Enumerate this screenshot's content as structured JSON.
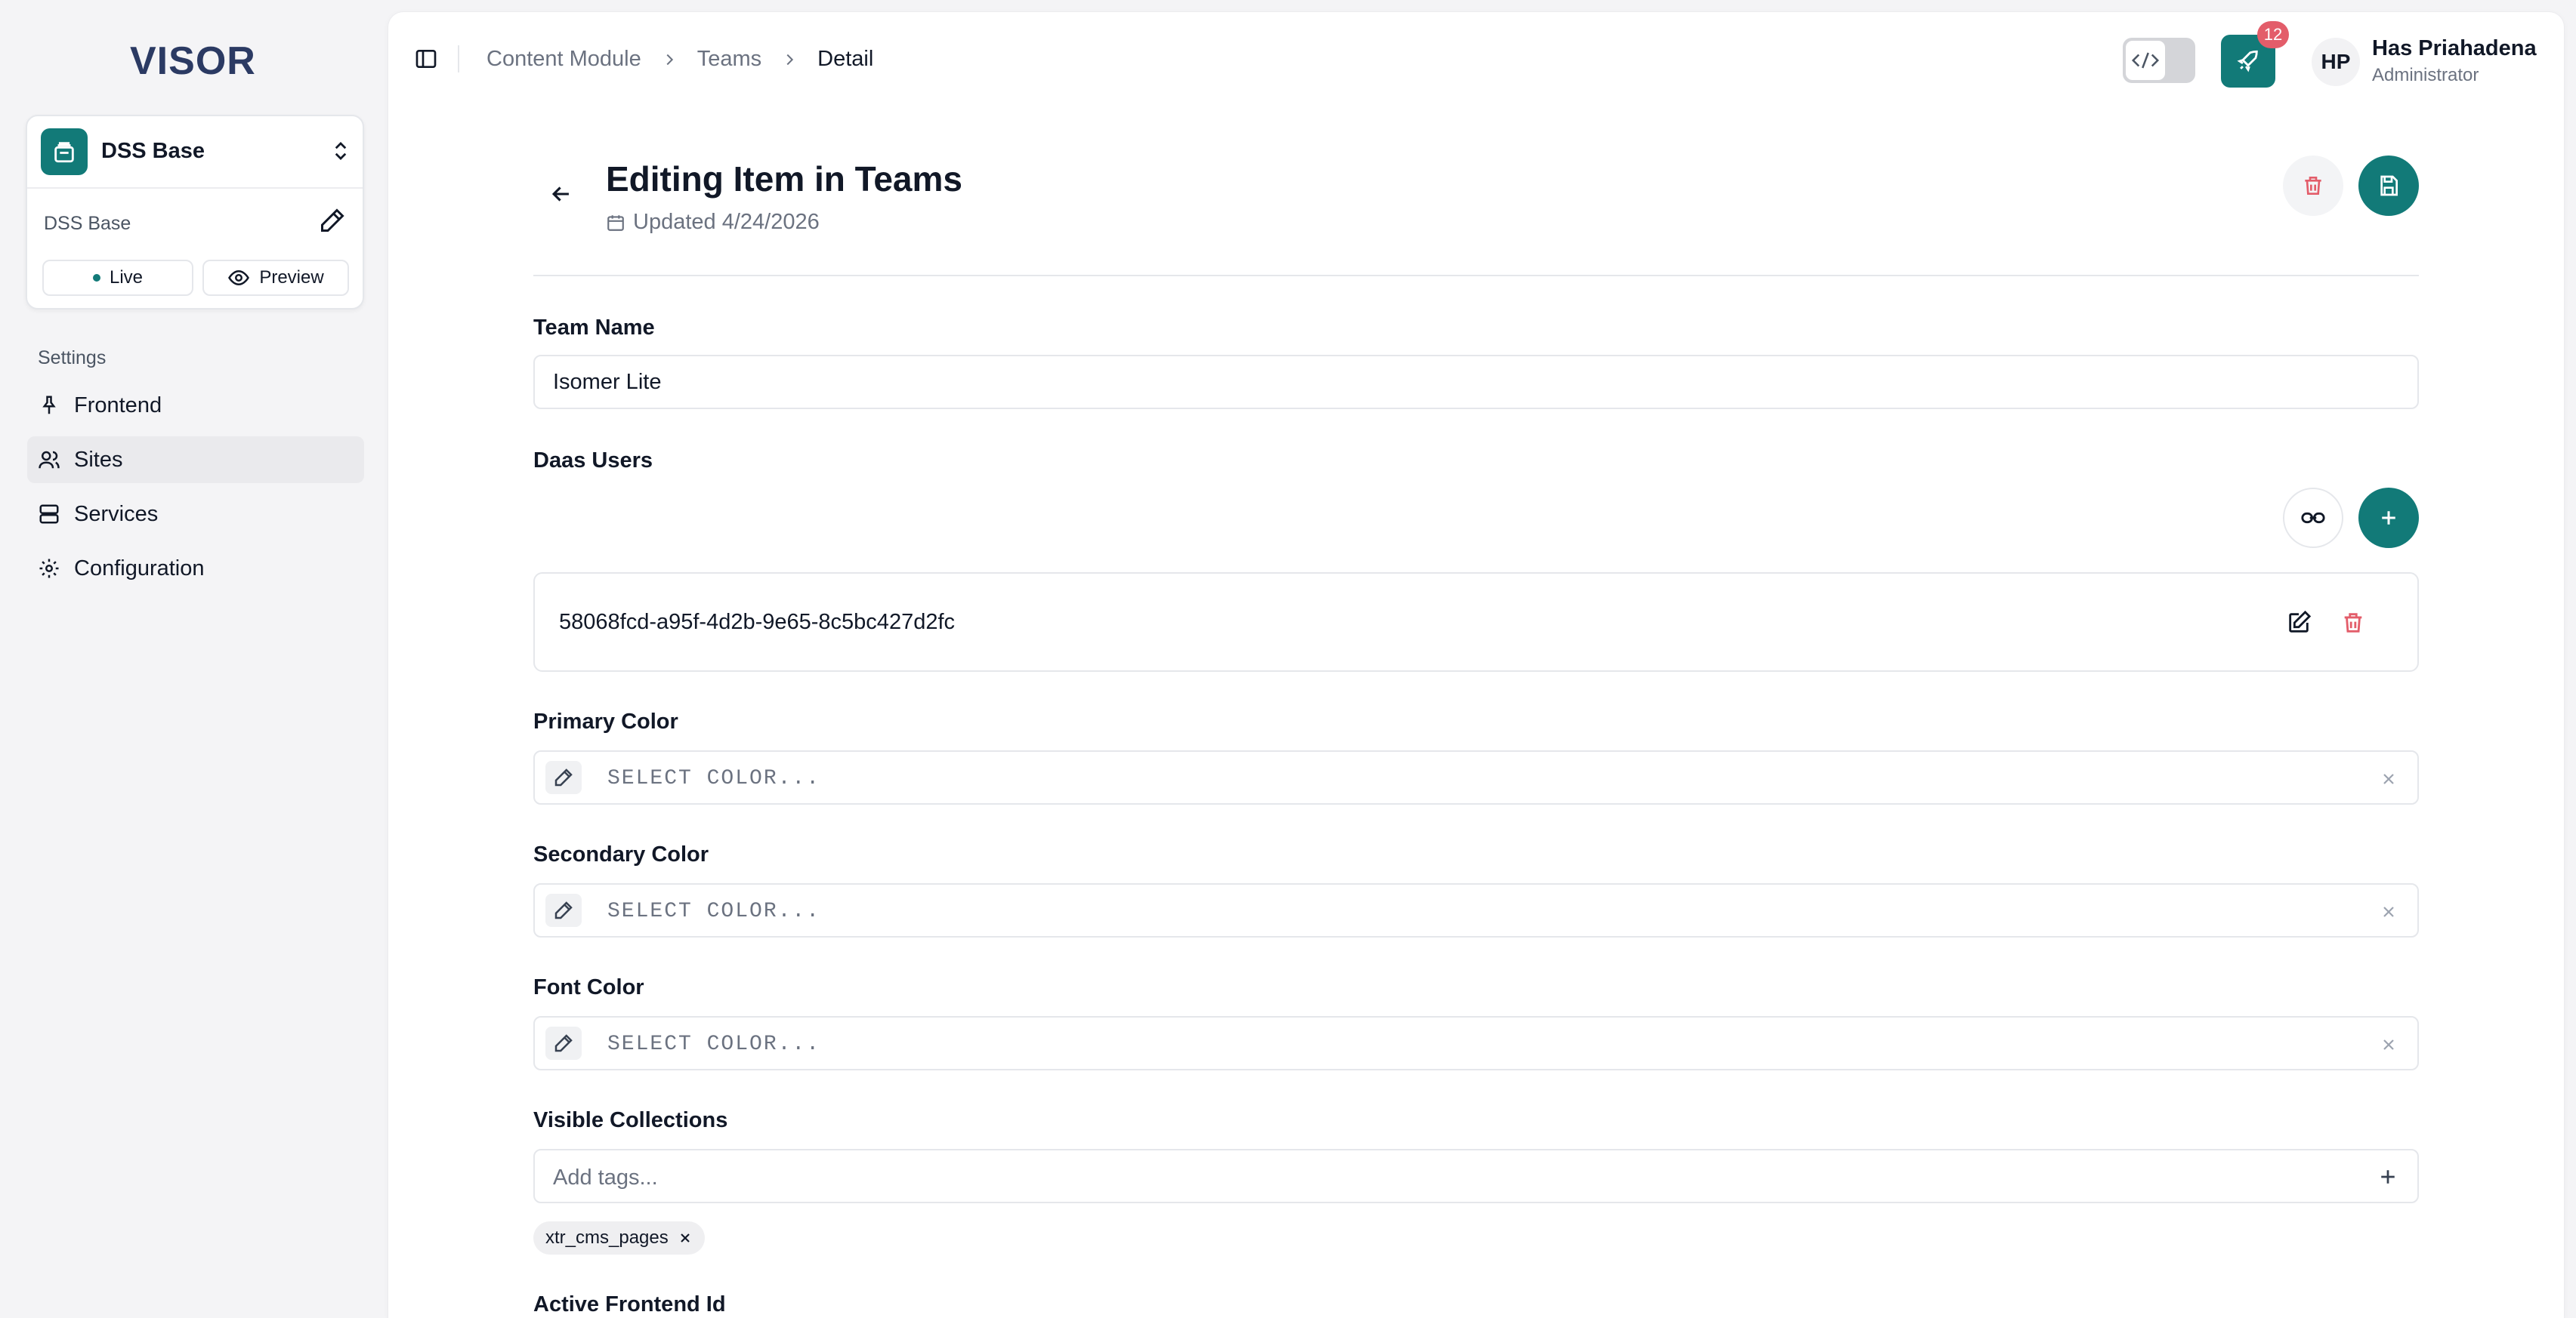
{
  "app": {
    "logo_text": "VISOR"
  },
  "site": {
    "name": "DSS Base",
    "subtitle": "DSS Base",
    "live_label": "Live",
    "preview_label": "Preview"
  },
  "nav": {
    "heading": "Settings",
    "items": [
      {
        "label": "Frontend",
        "icon": "pin-icon"
      },
      {
        "label": "Sites",
        "icon": "users-icon",
        "active": true
      },
      {
        "label": "Services",
        "icon": "server-icon"
      },
      {
        "label": "Configuration",
        "icon": "gear-icon"
      }
    ]
  },
  "breadcrumb": [
    "Content Module",
    "Teams",
    "Detail"
  ],
  "topbar": {
    "deploy_badge": "12"
  },
  "user": {
    "initials": "HP",
    "name": "Has Priahadena",
    "role": "Administrator"
  },
  "page": {
    "title": "Editing Item in Teams",
    "updated": "Updated 4/24/2026"
  },
  "form": {
    "team_name": {
      "label": "Team Name",
      "value": "Isomer Lite"
    },
    "daas_users": {
      "label": "Daas Users",
      "items": [
        "58068fcd-a95f-4d2b-9e65-8c5bc427d2fc"
      ]
    },
    "primary_color": {
      "label": "Primary Color",
      "placeholder": "SELECT COLOR..."
    },
    "secondary_color": {
      "label": "Secondary Color",
      "placeholder": "SELECT COLOR..."
    },
    "font_color": {
      "label": "Font Color",
      "placeholder": "SELECT COLOR..."
    },
    "visible_collections": {
      "label": "Visible Collections",
      "placeholder": "Add tags...",
      "tags": [
        "xtr_cms_pages"
      ]
    },
    "active_frontend": {
      "label": "Active Frontend Id"
    }
  },
  "colors": {
    "accent": "#127a78",
    "danger": "#e35d6a"
  }
}
